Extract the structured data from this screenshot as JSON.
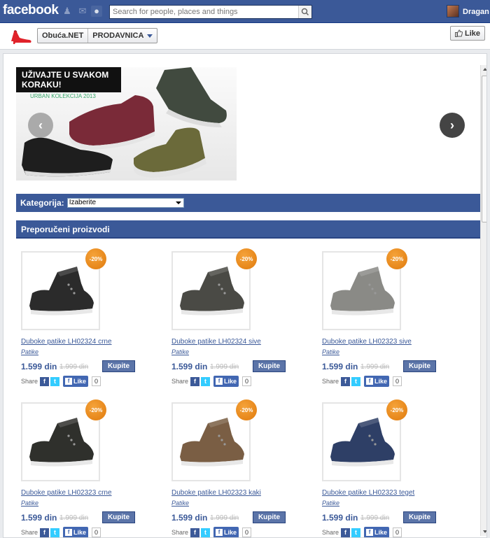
{
  "topbar": {
    "logo": "facebook",
    "search_placeholder": "Search for people, places and things",
    "user_name": "Dragan"
  },
  "page": {
    "name": "Obuća.NET",
    "tab": "PRODAVNICA",
    "like_label": "Like"
  },
  "banner": {
    "title": "UŽIVAJTE U SVAKOM KORAKU!",
    "subtitle": "URBAN KOLEKCIJA 2013"
  },
  "category": {
    "label": "Kategorija:",
    "selected": "Izaberite"
  },
  "recommended": {
    "title": "Preporučeni proizvodi"
  },
  "share": {
    "label": "Share",
    "like": "Like",
    "count": "0"
  },
  "products": [
    {
      "name": "Duboke patike LH02324 crne",
      "category": "Patike",
      "price": "1.599 din",
      "old_price": "1.999 din",
      "discount": "-20%",
      "buy": "Kupite",
      "color": "#2b2b2b"
    },
    {
      "name": "Duboke patike LH02324 sive",
      "category": "Patike",
      "price": "1.599 din",
      "old_price": "1.999 din",
      "discount": "-20%",
      "buy": "Kupite",
      "color": "#4a4a45"
    },
    {
      "name": "Duboke patike LH02323 sive",
      "category": "Patike",
      "price": "1.599 din",
      "old_price": "1.999 din",
      "discount": "-20%",
      "buy": "Kupite",
      "color": "#8a8a86"
    },
    {
      "name": "Duboke patike LH02323 crne",
      "category": "Patike",
      "price": "1.599 din",
      "old_price": "1.999 din",
      "discount": "-20%",
      "buy": "Kupite",
      "color": "#2f302c"
    },
    {
      "name": "Duboke patike LH02323 kaki",
      "category": "Patike",
      "price": "1.599 din",
      "old_price": "1.999 din",
      "discount": "-20%",
      "buy": "Kupite",
      "color": "#7a5e44"
    },
    {
      "name": "Duboke patike LH02323 teget",
      "category": "Patike",
      "price": "1.599 din",
      "old_price": "1.999 din",
      "discount": "-20%",
      "buy": "Kupite",
      "color": "#2e3f66"
    }
  ],
  "colors": {
    "facebook_blue": "#3b5998",
    "badge_orange": "#e88514"
  }
}
